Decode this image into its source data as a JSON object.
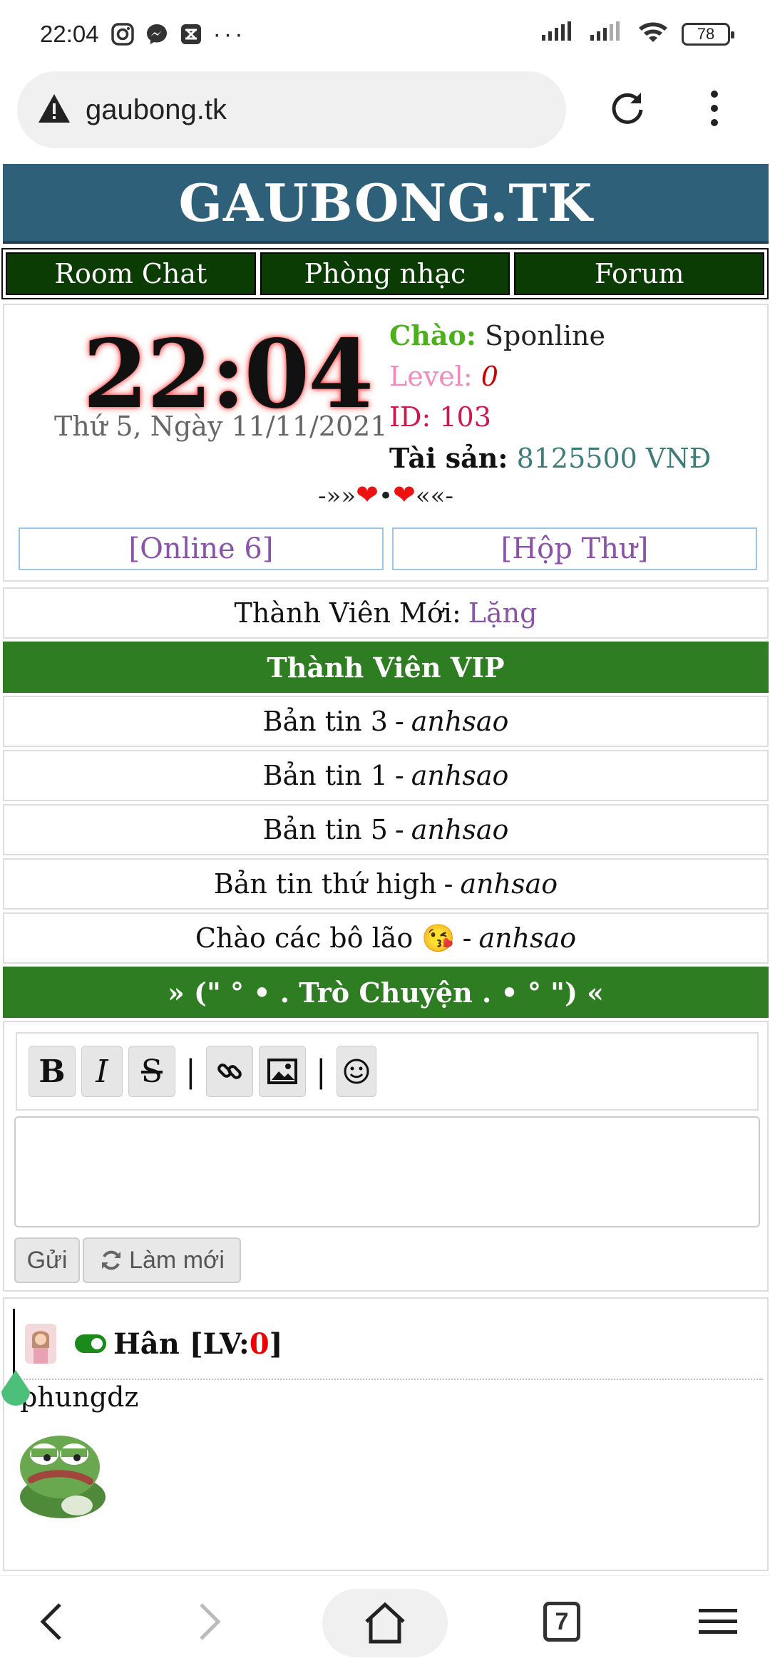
{
  "status_bar": {
    "time": "22:04",
    "battery": "78"
  },
  "browser": {
    "url": "gaubong.tk"
  },
  "site": {
    "title": "GAUBONG.TK",
    "nav": [
      "Room Chat",
      "Phòng nhạc",
      "Forum"
    ]
  },
  "info": {
    "clock": "22:04",
    "date": "Thứ 5, Ngày 11/11/2021",
    "greet_label": "Chào:",
    "greet_name": "Sponline",
    "level_label": "Level:",
    "level_value": "0",
    "id_text": "ID: 103",
    "assets_label": "Tài sản:",
    "assets_value": "8125500 VNĐ",
    "hearts_left": "-»»",
    "hearts_mid": "•",
    "hearts_right": "««-",
    "online_button": "[Online 6]",
    "mail_button": "[Hộp Thư]"
  },
  "new_member": {
    "label": "Thành Viên Mới:",
    "name": "Lặng"
  },
  "vip_heading": "Thành Viên VIP",
  "news": [
    {
      "title": "Bản tin 3",
      "author": "anhsao"
    },
    {
      "title": "Bản tin 1",
      "author": "anhsao"
    },
    {
      "title": "Bản tin 5",
      "author": "anhsao"
    },
    {
      "title": "Bản tin thứ high",
      "author": "anhsao"
    },
    {
      "title": "Chào các bô lão 😘",
      "author": "anhsao"
    }
  ],
  "dash": "-",
  "chat_heading": "» (\" ° • . Trò Chuyện . • ° \") «",
  "editor": {
    "bold": "B",
    "italic": "I",
    "strike": "S",
    "separator": "|",
    "send_label": "Gửi",
    "refresh_label": "Làm mới"
  },
  "message": {
    "user": "Hân",
    "lv_prefix": "[LV:",
    "lv_value": "0",
    "lv_suffix": "]",
    "text": "phungdz"
  },
  "bottom_nav": {
    "tab_count": "7"
  }
}
